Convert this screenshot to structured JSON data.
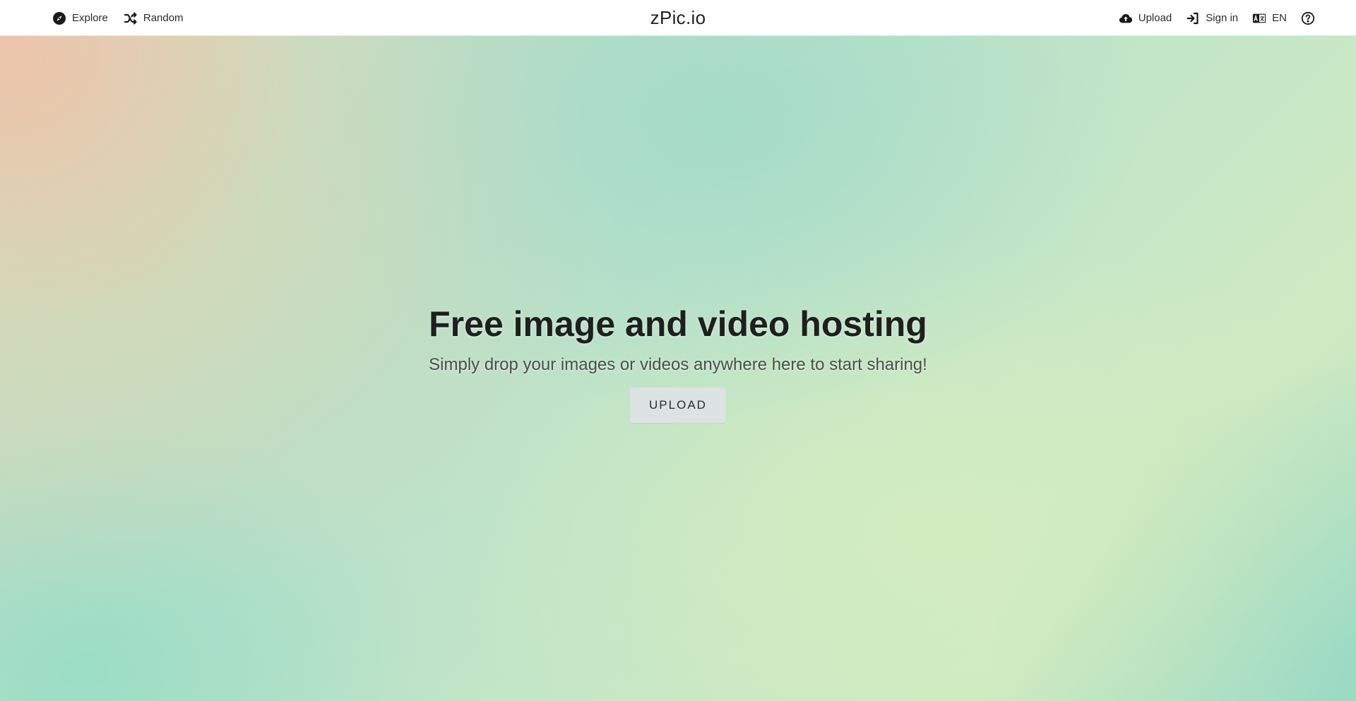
{
  "header": {
    "left": [
      {
        "label": "Explore",
        "icon": "compass-icon"
      },
      {
        "label": "Random",
        "icon": "shuffle-icon"
      }
    ],
    "brand": "zPic.io",
    "right": [
      {
        "label": "Upload",
        "icon": "cloud-upload-icon"
      },
      {
        "label": "Sign in",
        "icon": "sign-in-icon"
      },
      {
        "label": "EN",
        "icon": "language-icon"
      },
      {
        "label": "",
        "icon": "help-icon"
      }
    ]
  },
  "hero": {
    "title": "Free image and video hosting",
    "subtitle": "Simply drop your images or videos anywhere here to start sharing!",
    "button_label": "UPLOAD"
  },
  "colors": {
    "button_bg": "#dde2e2",
    "text_dark": "#1e1f1e",
    "text_muted": "#4a4f4c"
  }
}
